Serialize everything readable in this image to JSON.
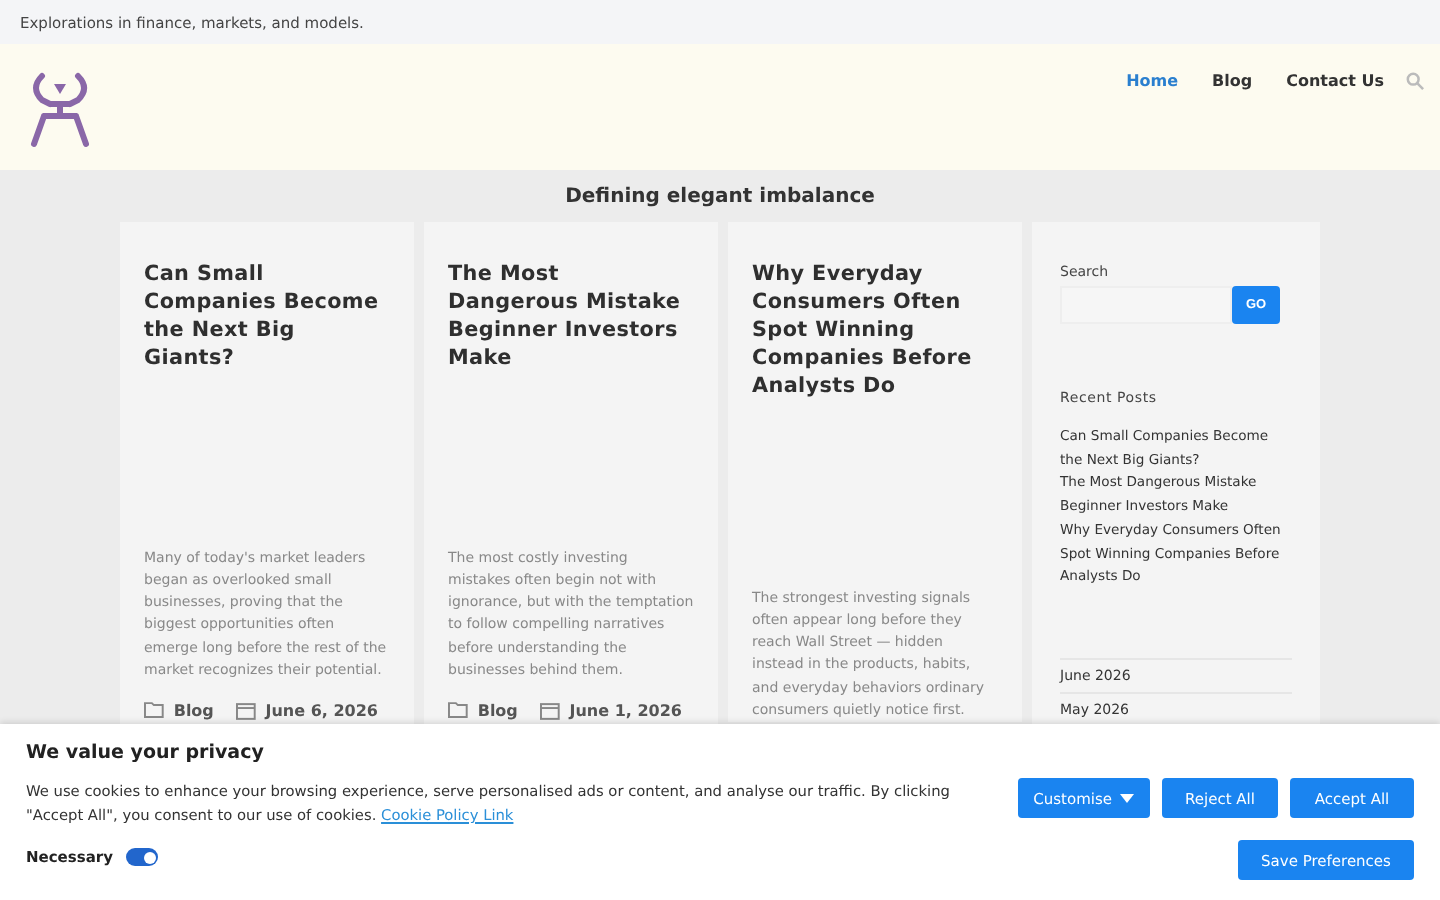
{
  "tagline": "Explorations in finance, markets, and models.",
  "nav": [
    {
      "label": "Home",
      "selected": true
    },
    {
      "label": "Blog",
      "selected": false
    },
    {
      "label": "Contact Us",
      "selected": false
    }
  ],
  "page_title": "Defining elegant imbalance",
  "posts": [
    {
      "title": "Can Small Companies Become the Next Big Giants?",
      "excerpt": "Many of today's market leaders began as overlooked small businesses, proving that the biggest opportunities often emerge long before the rest of the market recognizes their potential.",
      "category": "Blog",
      "date": "June 6, 2026"
    },
    {
      "title": "The Most Dangerous Mistake Beginner Investors Make",
      "excerpt": "The most costly investing mistakes often begin not with ignorance, but with the temptation to follow compelling narratives before understanding the businesses behind them.",
      "category": "Blog",
      "date": "June 1, 2026"
    },
    {
      "title": "Why Everyday Consumers Often Spot Winning Companies Before Analysts Do",
      "excerpt": "The strongest investing signals often appear long before they reach Wall Street — hidden instead in the products, habits, and everyday behaviors ordinary consumers quietly notice first."
    }
  ],
  "sidebar": {
    "search_label": "Search",
    "search_button": "GO",
    "recent_heading": "Recent Posts",
    "recent_posts": [
      "Can Small Companies Become the Next Big Giants?",
      "The Most Dangerous Mistake Beginner Investors Make",
      "Why Everyday Consumers Often Spot Winning Companies Before Analysts Do"
    ],
    "archives": [
      "June 2026",
      "May 2026"
    ]
  },
  "cookie_banner": {
    "title": "We value your privacy",
    "text": "We use cookies to enhance your browsing experience, serve personalised ads or content, and analyse our traffic. By clicking \"Accept All\", you consent to our use of cookies.",
    "link": "Cookie Policy Link",
    "toggle_label": "Necessary",
    "toggle_on": true,
    "buttons": [
      {
        "label": "Customise",
        "kind": "dropdown"
      },
      {
        "label": "Reject All",
        "kind": "plain"
      },
      {
        "label": "Accept All",
        "kind": "plain"
      }
    ],
    "save_button": "Save Preferences"
  }
}
